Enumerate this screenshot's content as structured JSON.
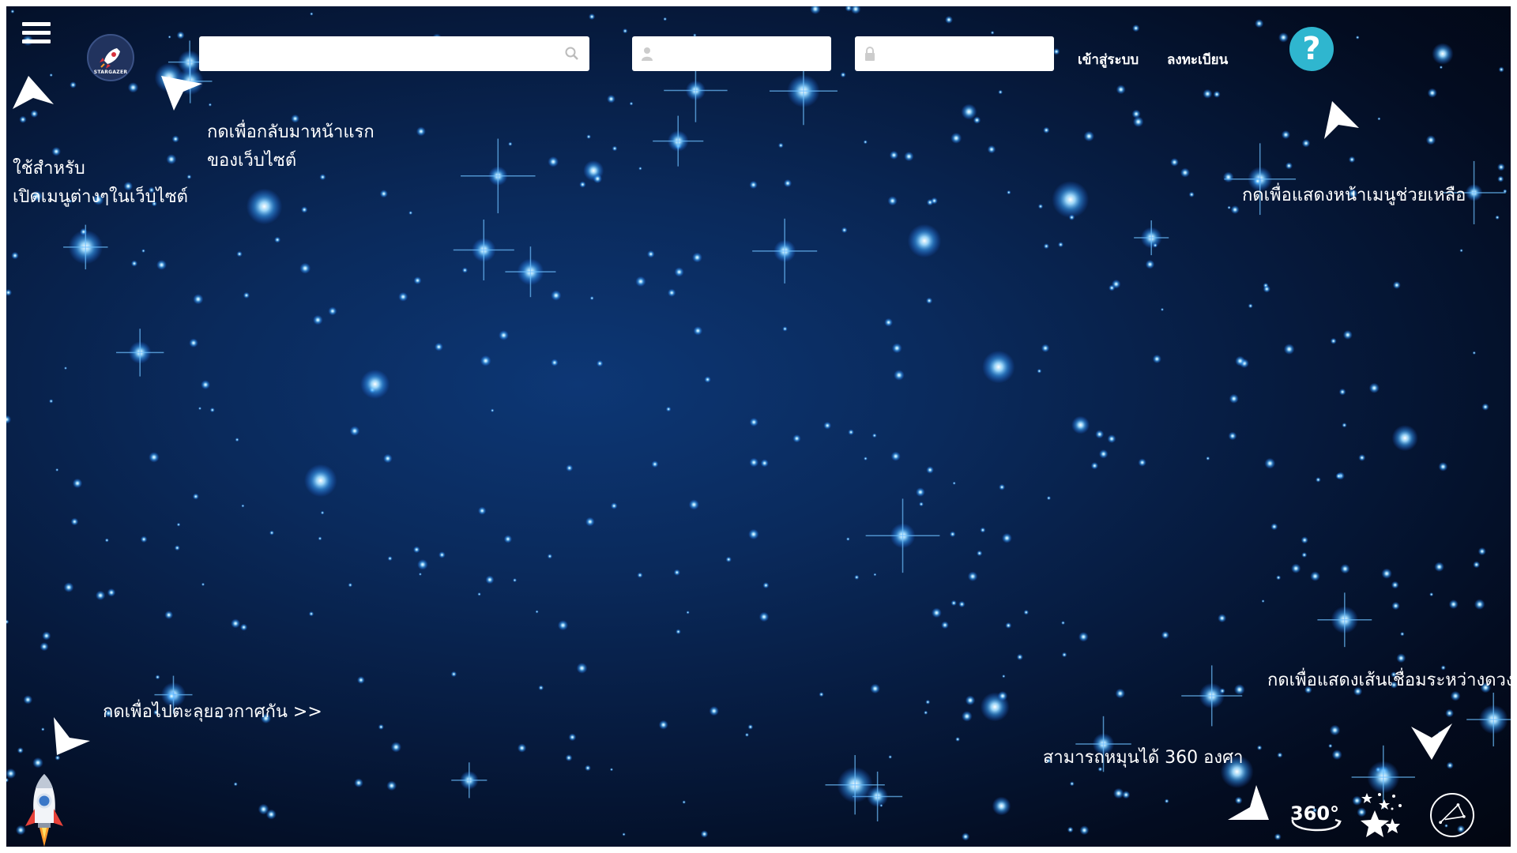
{
  "header": {
    "menu_icon": "hamburger-menu-icon",
    "logo": {
      "text": "STARGAZER",
      "icon": "rocket-icon"
    },
    "search": {
      "placeholder": "",
      "value": "",
      "icon": "search-icon"
    },
    "username": {
      "placeholder": "",
      "value": "",
      "icon": "user-icon"
    },
    "password": {
      "placeholder": "",
      "value": "",
      "icon": "lock-icon"
    },
    "login_label": "เข้าสู่ระบบ",
    "register_label": "ลงทะเบียน",
    "help_label": "?"
  },
  "hints": {
    "menu": [
      "ใช้สำหรับ",
      "เปิดเมนูต่างๆในเว็บไซต์"
    ],
    "home": [
      "กดเพื่อกลับมาหน้าแรก",
      "ของเว็บไซต์"
    ],
    "help": "กดเพื่อแสดงหน้าเมนูช่วยเหลือ",
    "travel": "กดเพื่อไปตะลุยอวกาศกัน >>",
    "rotate": "สามารถหมุนได้ 360 องศา",
    "constellation": "กดเพื่อแสดงเส้นเชื่อมระหว่างดวงดาว"
  },
  "tools": {
    "rotate_label": "360°",
    "rotate_icon": "360-rotate-icon",
    "stars_icon": "stars-icon",
    "constellation_icon": "constellation-icon",
    "rocket_icon": "rocket-launch-icon"
  },
  "colors": {
    "help_button": "#2fb6cf",
    "star_glow": "#3fa8ff",
    "background": "#0a2a5c"
  }
}
